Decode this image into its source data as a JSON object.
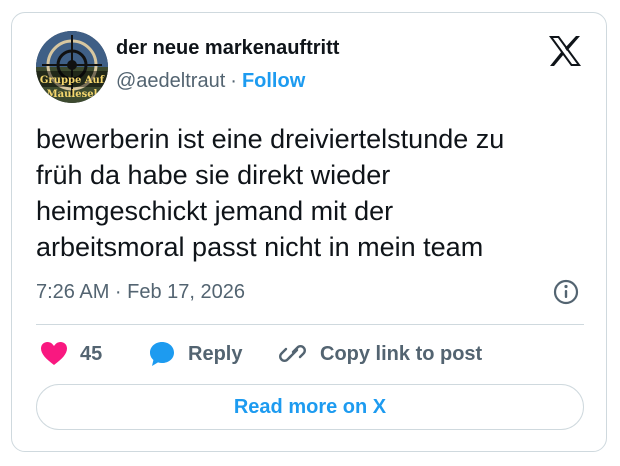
{
  "author": {
    "display_name": "der neue markenauftritt",
    "handle": "@aedeltraut",
    "separator": "·",
    "follow_label": "Follow",
    "avatar_text_top": "Gruppe Auf",
    "avatar_text_bottom": "Maulesel"
  },
  "tweet": {
    "lines": [
      "bewerberin ist eine dreiviertelstunde zu",
      "früh da habe sie direkt wieder",
      "heimgeschickt jemand mit der",
      "arbeitsmoral passt nicht in mein team"
    ],
    "timestamp": "7:26 AM · Feb 17, 2026"
  },
  "actions": {
    "like_count": "45",
    "reply_label": "Reply",
    "copy_label": "Copy link to post"
  },
  "footer": {
    "read_more_label": "Read more on X"
  },
  "icons": {
    "brand": "x-logo-icon",
    "info": "info-icon",
    "like": "heart-icon",
    "reply": "speech-bubble-icon",
    "copy": "link-icon"
  },
  "colors": {
    "accent": "#1d9bf0",
    "heart": "#f91880",
    "text": "#0f1419",
    "muted": "#536471",
    "border": "#cfd9de"
  }
}
